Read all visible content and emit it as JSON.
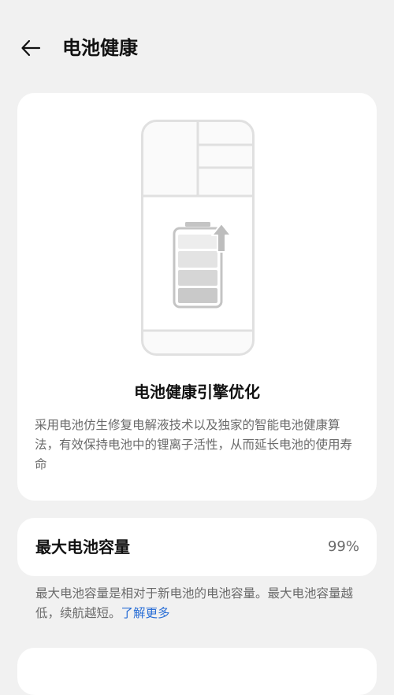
{
  "header": {
    "back_icon": "arrow-left-icon",
    "title": "电池健康"
  },
  "hero": {
    "illustration_icon": "battery-upgrade-icon",
    "title": "电池健康引擎优化",
    "description": "采用电池仿生修复电解液技术以及独家的智能电池健康算法，有效保持电池中的锂离子活性，从而延长电池的使用寿命"
  },
  "capacity": {
    "label": "最大电池容量",
    "value": "99%",
    "note": "最大电池容量是相对于新电池的电池容量。最大电池容量越低，续航越短。",
    "link_label": "了解更多",
    "link_color": "#2b6fd6"
  },
  "colors": {
    "background": "#f1f1f1",
    "card": "#ffffff",
    "secondary_text": "#6a6a6a"
  }
}
